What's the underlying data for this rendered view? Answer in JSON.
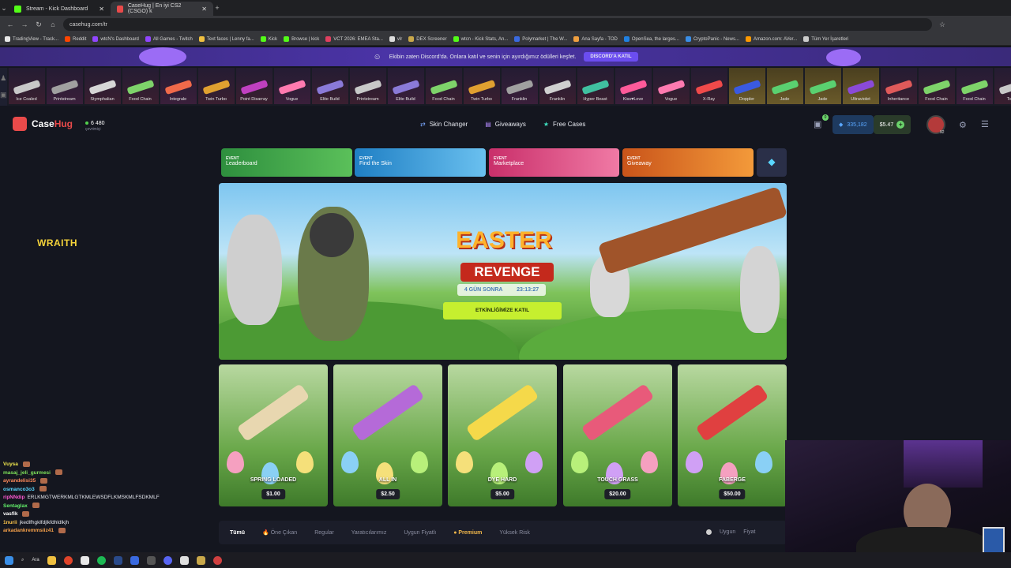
{
  "browser": {
    "tabs": [
      {
        "label": "Stream - Kick Dashboard",
        "active": false,
        "icon": "kick-icon"
      },
      {
        "label": "CaseHug | En iyi CS2 (CSGO) k",
        "active": true,
        "icon": "casehug-icon"
      }
    ],
    "url": "casehug.com/tr",
    "bookmarks": [
      "TradingView - Track...",
      "Reddit",
      "wtcN's Dashboard",
      "All Games - Twitch",
      "Text faces | Lenny fa...",
      "Kick",
      "Browse | kick",
      "VCT 2026: EMEA Sta...",
      "vlr",
      "DEX Screener",
      "wtcn - Kick Stats, An...",
      "Polymarket | The W...",
      "Ana Sayfa - TOD",
      "OpenSea, the larges...",
      "CryptoPanic - News...",
      "Amazon.com: AVer...",
      "Tüm Yer İşaretleri"
    ]
  },
  "discord_banner": {
    "text": "Ekibin zaten Discord'da. Onlara katıl ve senin için ayırdığımız ödülleri keşfet.",
    "button": "DISCORD'A KATIL"
  },
  "live_drops": [
    "Ice Coaled",
    "Printstream",
    "Stymphalian",
    "Food Chain",
    "Integrale",
    "Twin Turbo",
    "Point Disarray",
    "Vogue",
    "Elite Build",
    "Printstream",
    "Elite Build",
    "Food Chain",
    "Twin Turbo",
    "Franklin",
    "Franklin",
    "Hyper Beast",
    "Kiss♥Love",
    "Vogue",
    "X-Ray",
    "Doppler",
    "Jade",
    "Jade",
    "Ultraviolet",
    "Inheritance",
    "Food Chain",
    "Food Chain",
    "Tooth"
  ],
  "header": {
    "logo_a": "Case",
    "logo_b": "Hug",
    "online_count": "6 480",
    "online_label": "çevrimiçi",
    "nav": [
      "Skin Changer",
      "Giveaways",
      "Free Cases"
    ],
    "bag_badge": "0",
    "coins": "335,182",
    "balance": "$5.47",
    "level": "92"
  },
  "events": [
    {
      "tag": "EVENT",
      "label": "Leaderboard",
      "color": "#3aa34a"
    },
    {
      "tag": "EVENT",
      "label": "Find the Skin",
      "color": "#2b8fd6"
    },
    {
      "tag": "EVENT",
      "label": "Marketplace",
      "color": "#d93a7a"
    },
    {
      "tag": "EVENT",
      "label": "Giveaway",
      "color": "#e06a1f"
    }
  ],
  "overlay_label": "WRAITH",
  "hero": {
    "title": "EASTER",
    "subtitle": "REVENGE",
    "timer_days": "4 GÜN SONRA",
    "timer_time": "23:13:27",
    "cta": "ETKİNLİĞİMİZE KATIL"
  },
  "cases": [
    {
      "name": "SPRING LOADED",
      "price": "$1.00",
      "color": "#e8d7b0"
    },
    {
      "name": "ALL IN",
      "price": "$2.50",
      "color": "#b56ad8"
    },
    {
      "name": "DYE HARD",
      "price": "$5.00",
      "color": "#f5d94a"
    },
    {
      "name": "TOUCH GRASS",
      "price": "$20.00",
      "color": "#e85a7a"
    },
    {
      "name": "FABERGE",
      "price": "$50.00",
      "color": "#e04040"
    }
  ],
  "filters": {
    "tabs": [
      "Tümü",
      "Öne Çıkan",
      "Regular",
      "Yaratıcılarımız",
      "Uygun Fiyatlı",
      "Premium",
      "Yüksek Risk"
    ],
    "sort_a": "Uygun",
    "sort_b": "Fiyat"
  },
  "chat": [
    {
      "user": "Vuysa",
      "msg": "",
      "color": "#f2e94e"
    },
    {
      "user": "masaj_jeli_gurmesi",
      "msg": "",
      "color": "#7fe35a"
    },
    {
      "user": "ayrandelisi35",
      "msg": "",
      "color": "#ff8a5a"
    },
    {
      "user": "osmanco3o3",
      "msg": "",
      "color": "#5ad7ff"
    },
    {
      "user": "ripNNdip",
      "msg": "ERLKMGTWERKMLGTKMLEWSDFLKMSKMLFSDKMLF",
      "color": "#ff5ad2"
    },
    {
      "user": "Sentaglax",
      "msg": "",
      "color": "#62f06a"
    },
    {
      "user": "vasfik",
      "msg": "",
      "color": "#ffffff"
    },
    {
      "user": "1nurii",
      "msg": "jkedlfhgklfdjlkfdhldlkjh",
      "color": "#ffc64a"
    },
    {
      "user": "arkadankremmsiiz41",
      "msg": "",
      "color": "#f5a04a"
    }
  ],
  "taskbar": {
    "search": "Ara"
  }
}
